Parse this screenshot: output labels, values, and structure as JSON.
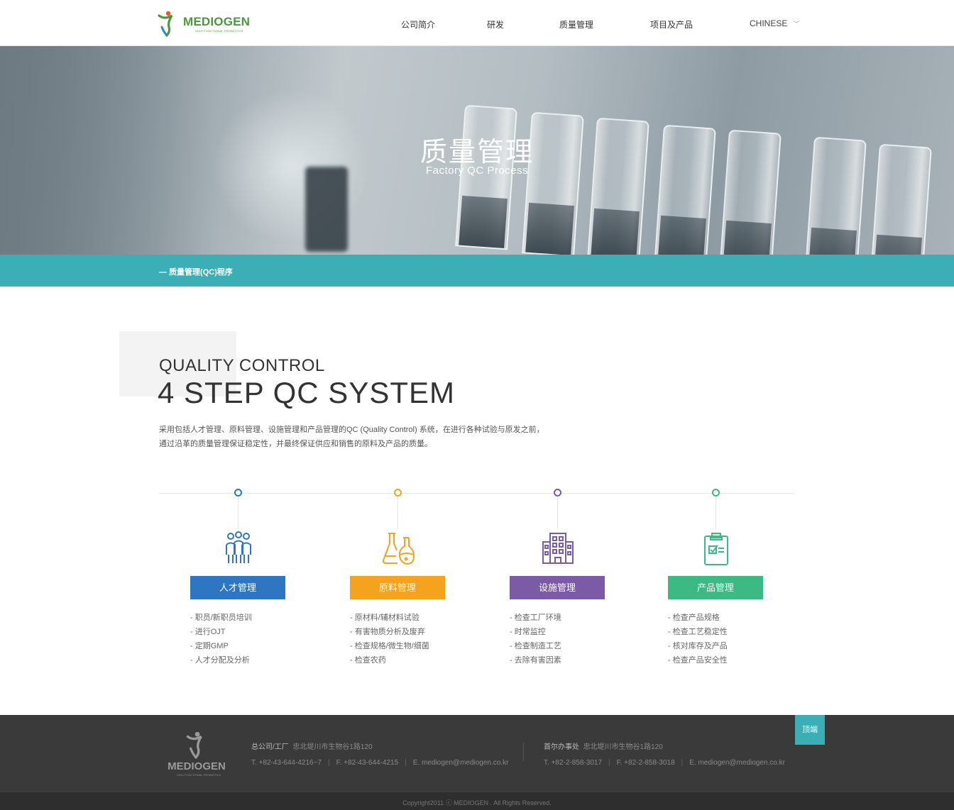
{
  "header": {
    "logo_text": "MEDIOGEN",
    "logo_sub": "HIGH FUNCTIONAL PROBIOTICS",
    "nav": [
      "公司简介",
      "研发",
      "质量管理",
      "项目及产品"
    ],
    "language": "CHINESE"
  },
  "hero": {
    "title": "质量管理",
    "subtitle": "Factory QC Process"
  },
  "breadcrumb": "— 质量管理(QC)程序",
  "intro": {
    "kicker": "QUALITY CONTROL",
    "title": "4 STEP QC SYSTEM",
    "desc_line1": "采用包括人才管理、原料管理、设施管理和产品管理的QC (Quality Control) 系统，在进行各种试验与原发之前，",
    "desc_line2": "通过沿革的质量管理保证稳定性，并最终保证供应和销售的原料及产品的质量。"
  },
  "steps": [
    {
      "label": "人才管理",
      "color": "#2e75c2",
      "icon": "people-icon",
      "items": [
        "- 职员/新职员培训",
        "- 进行OJT",
        "- 定期GMP",
        "- 人才分配及分析"
      ]
    },
    {
      "label": "原料管理",
      "color": "#f5a21e",
      "icon": "flask-icon",
      "items": [
        "- 原材料/辅材料试验",
        "- 有害物质分析及废弃",
        "- 检查规格/微生物/细菌",
        "- 检查农药"
      ]
    },
    {
      "label": "设施管理",
      "color": "#7b5aa6",
      "icon": "building-icon",
      "items": [
        "- 检查工厂环境",
        "- 时常监控",
        "- 检查制造工艺",
        "- 去除有害因素"
      ]
    },
    {
      "label": "产品管理",
      "color": "#3dba84",
      "icon": "clipboard-icon",
      "items": [
        "- 检查产品规格",
        "- 检查工艺稳定性",
        "- 核对库存及产品",
        "- 检查产品安全性"
      ]
    }
  ],
  "footer": {
    "logo_text": "MEDIOGEN",
    "logo_sub": "HIGH FUNCTIONAL PROBIOTICS",
    "hq_label": "总公司/工厂",
    "hq_address": "忠北堤川市生物谷1路120",
    "hq_tel": "T. +82-43-644-4216~7",
    "hq_fax": "F. +82-43-644-4215",
    "hq_email": "E. mediogen@mediogen.co.kr",
    "seoul_label": "首尔办事处",
    "seoul_address": "忠北堤川市生物谷1路120",
    "seoul_tel": "T. +82-2-858-3017",
    "seoul_fax": "F. +82-2-858-3018",
    "seoul_email": "E. mediogen@mediogen.co.kr",
    "top_button": "顶端",
    "copyright": "Copyright2011 ⓒ MEDIOGEN . All Rights Reserved."
  }
}
